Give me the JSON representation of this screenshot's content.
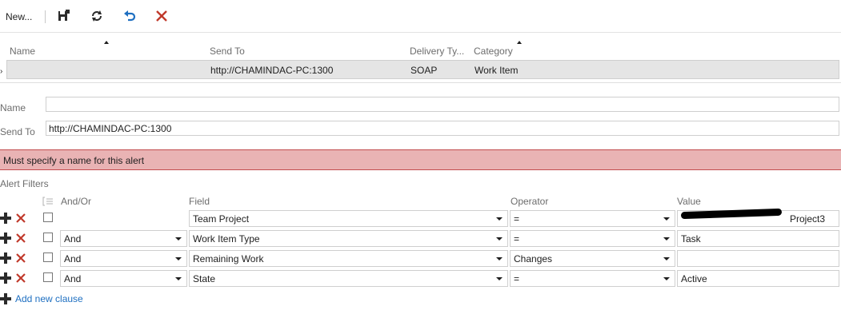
{
  "toolbar": {
    "new_label": "New...",
    "icons": [
      "save-icon",
      "refresh-icon",
      "undo-icon",
      "delete-icon"
    ],
    "colors": {
      "undo": "#1e6fc1",
      "delete": "#c0392b"
    }
  },
  "grid": {
    "columns": [
      "Name",
      "Send To",
      "Delivery Ty...",
      "Category"
    ],
    "row": {
      "name": "",
      "send_to": "http://CHAMINDAC-PC:1300",
      "delivery_type": "SOAP",
      "category": "Work Item"
    },
    "row_marker": "›"
  },
  "form": {
    "name_label": "Name",
    "name_value": "",
    "send_to_label": "Send To",
    "send_to_value": "http://CHAMINDAC-PC:1300"
  },
  "error": {
    "message": "Must specify a name for this alert",
    "color": "#e9b3b4"
  },
  "filters": {
    "section_title": "Alert Filters",
    "headers": {
      "andor": "And/Or",
      "field": "Field",
      "operator": "Operator",
      "value": "Value"
    },
    "rows": [
      {
        "andor": "",
        "field": "Team Project",
        "operator": "=",
        "value": "Project3"
      },
      {
        "andor": "And",
        "field": "Work Item Type",
        "operator": "=",
        "value": "Task"
      },
      {
        "andor": "And",
        "field": "Remaining Work",
        "operator": "Changes",
        "value": ""
      },
      {
        "andor": "And",
        "field": "State",
        "operator": "=",
        "value": "Active"
      }
    ],
    "add_clause_label": "Add new clause",
    "link_color": "#1e6fc1"
  }
}
